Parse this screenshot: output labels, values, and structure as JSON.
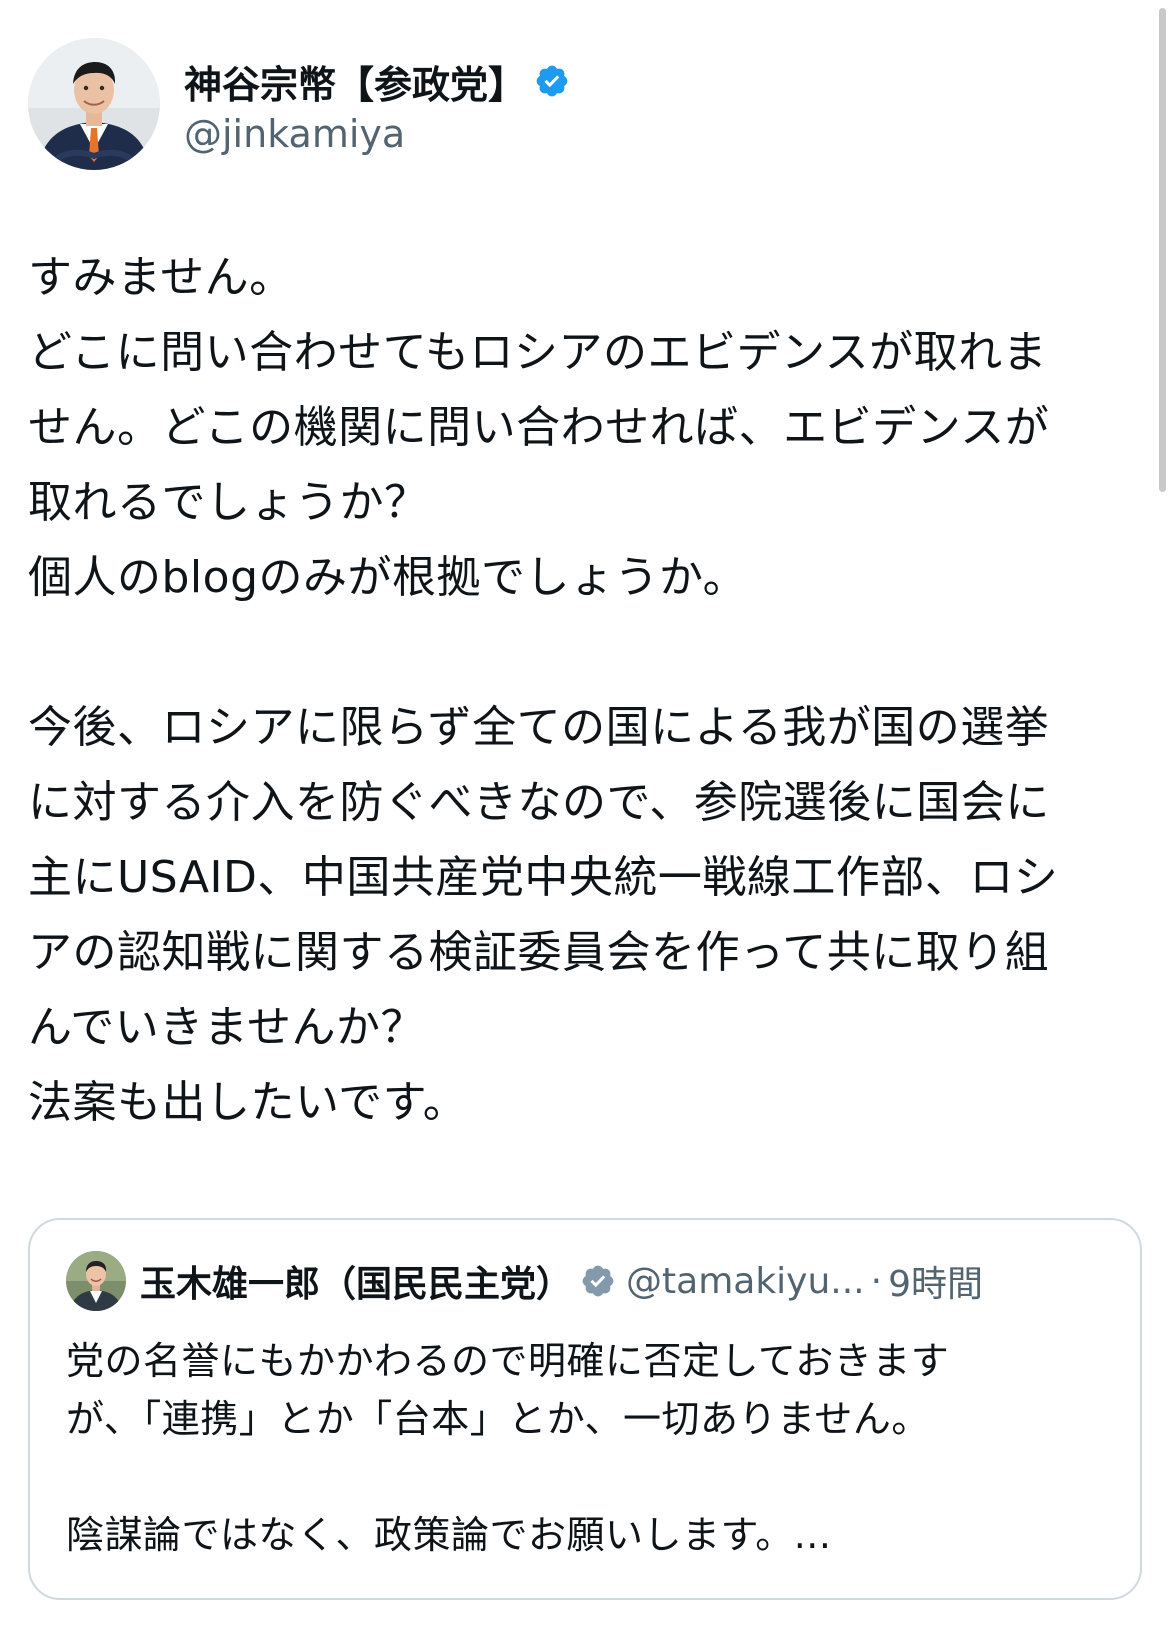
{
  "author": {
    "name": "神谷宗幣【参政党】",
    "handle": "@jinkamiya",
    "verified": true,
    "avatar_icon": "profile-photo-man-in-suit"
  },
  "tweet": {
    "lines": [
      "すみません。",
      "どこに問い合わせてもロシアのエビデンスが取れま",
      "せん。どこの機関に問い合わせれば、エビデンスが",
      "取れるでしょうか？",
      "個人のblogのみが根拠でしょうか。",
      "",
      "今後、ロシアに限らず全ての国による我が国の選挙",
      "に対する介入を防ぐべきなので、参院選後に国会に",
      "主にUSAID、中国共産党中央統一戦線工作部、ロシ",
      "アの認知戦に関する検証委員会を作って共に取り組",
      "んでいきませんか？",
      "法案も出したいです。"
    ]
  },
  "quote": {
    "name": "玉木雄一郎（国民民主党）",
    "handle": "@tamakiyu...",
    "separator": "·",
    "time": "9時間",
    "verified": true,
    "avatar_icon": "profile-photo-man-smiling",
    "lines": [
      "党の名誉にもかかわるので明確に否定しておきます",
      "が、「連携」とか「台本」とか、一切ありません。",
      "",
      "陰謀論ではなく、政策論でお願いします。..."
    ]
  },
  "colors": {
    "verified_blue": "#1d9bf0",
    "verified_gray": "#829aab",
    "secondary_text": "#536471",
    "border": "#cfd9de"
  }
}
